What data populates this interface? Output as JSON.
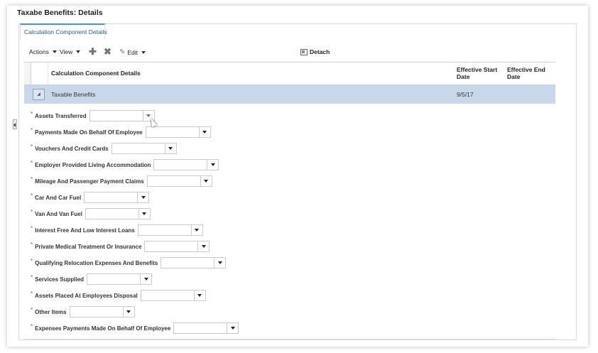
{
  "page": {
    "title": "Taxabe Benefits: Details"
  },
  "tab": {
    "label": "Calculation Component Details"
  },
  "toolbar": {
    "actions_label": "Actions",
    "view_label": "View",
    "edit_label": "Edit",
    "detach_label": "Detach"
  },
  "table": {
    "headers": {
      "component": "Calculation Component Details",
      "start_line1": "Effective Start",
      "start_line2": "Date",
      "end_line1": "Effective End",
      "end_line2": "Date"
    },
    "row": {
      "name": "Taxable Benefits",
      "start": "9/5/17",
      "end": ""
    }
  },
  "form": {
    "required_marker": "*",
    "fields": [
      {
        "label": "Assets Transferred"
      },
      {
        "label": "Payments Made On Behalf Of Employee"
      },
      {
        "label": "Vouchers And Credit Cards"
      },
      {
        "label": "Employer Provided Living Accommodation"
      },
      {
        "label": "Mileage And Passenger Payment Claims"
      },
      {
        "label": "Car And Car Fuel"
      },
      {
        "label": "Van And Van Fuel"
      },
      {
        "label": "Interest Free And Low Interest Loans"
      },
      {
        "label": "Private Medical Treatment Or Insurance"
      },
      {
        "label": "Qualifying Relocation Expenses And Benefits"
      },
      {
        "label": "Services Supplied"
      },
      {
        "label": "Assets Placed At Employees Disposal"
      },
      {
        "label": "Other Items"
      },
      {
        "label": "Expenses Payments Made On Behalf Of Employee"
      }
    ]
  }
}
